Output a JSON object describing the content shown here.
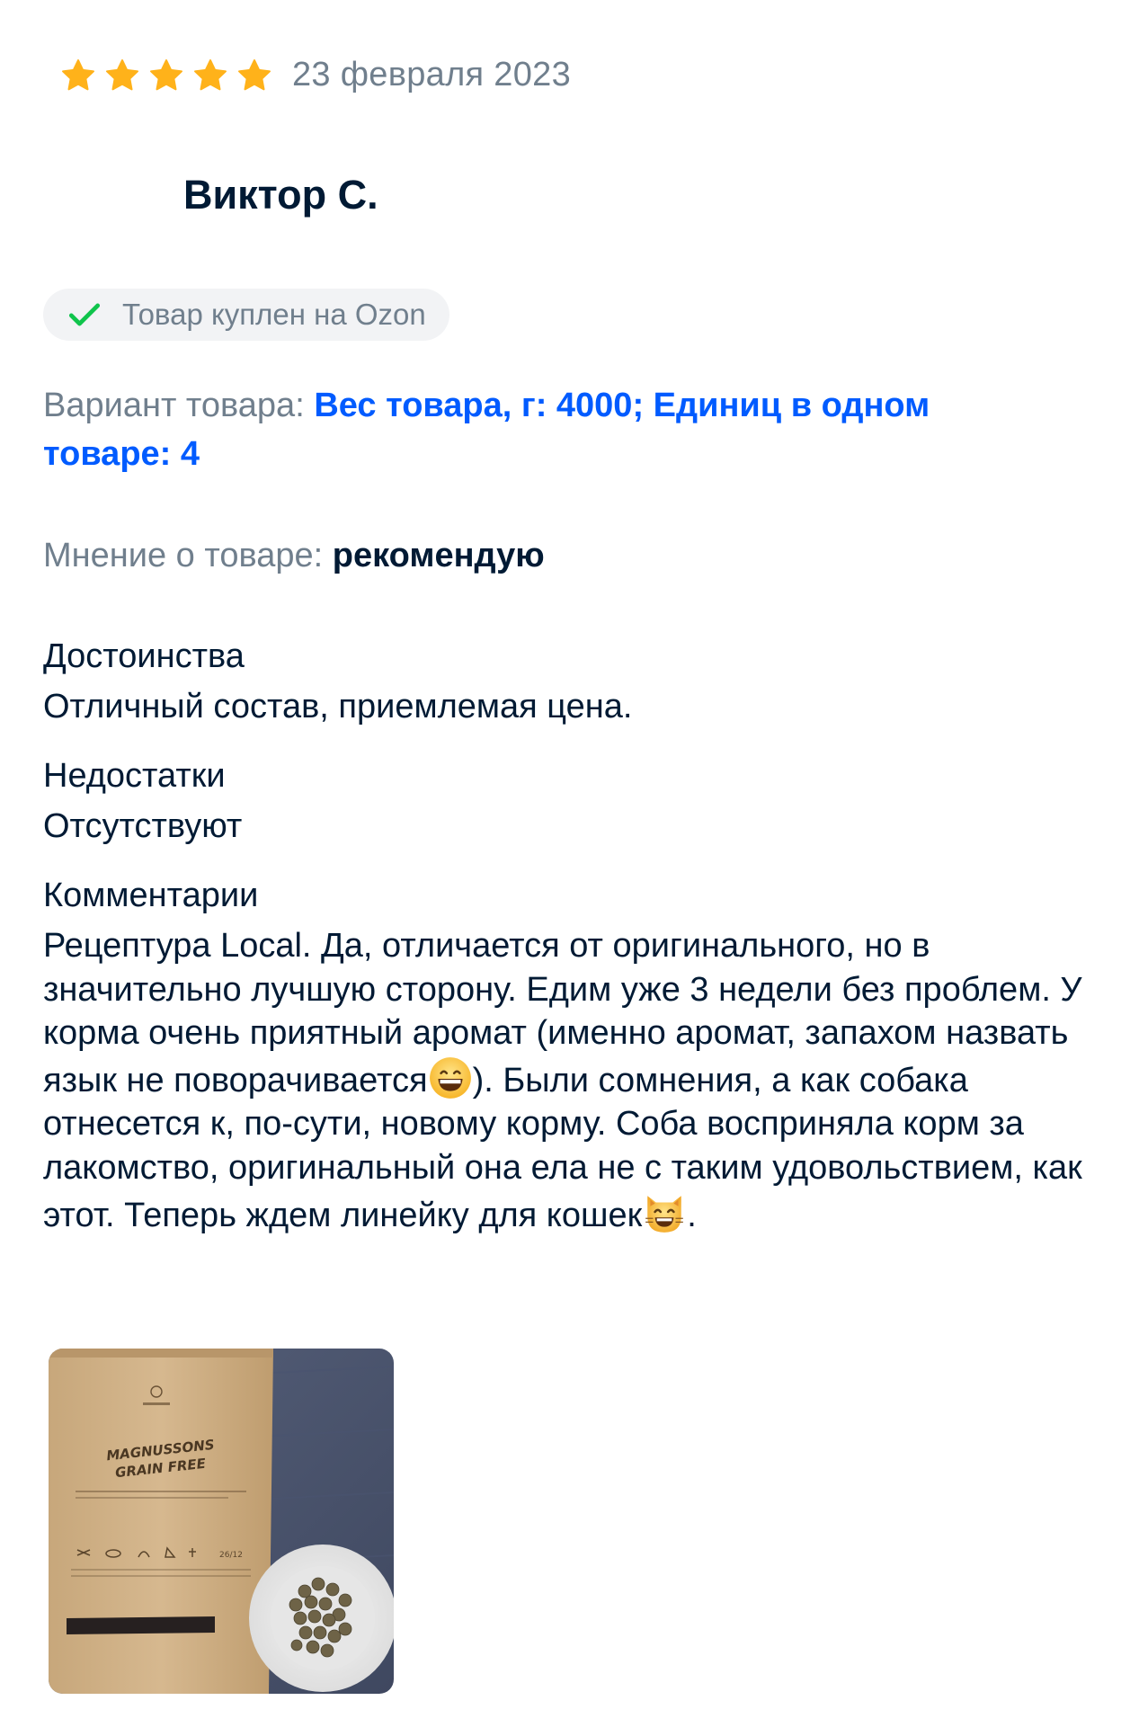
{
  "review": {
    "rating": 5,
    "rating_max": 5,
    "star_color": "#ffb21a",
    "date": "23 февраля 2023",
    "author": "Виктор С.",
    "purchased_badge": "Товар куплен на Ozon",
    "variant": {
      "label": "Вариант товара:",
      "value": "Вес товара, г: 4000; Единиц в одном товаре: 4"
    },
    "opinion": {
      "label": "Мнение о товаре:",
      "value": "рекомендую"
    },
    "pros": {
      "title": "Достоинства",
      "text": "Отличный состав, приемлемая цена."
    },
    "cons": {
      "title": "Недостатки",
      "text": "Отсутствуют"
    },
    "comments": {
      "title": "Комментарии",
      "text_1": "Рецептура Local. Да, отличается от оригинального, но в значительно лучшую сторону. Едим уже 3 недели без проблем. У корма очень приятный аромат (именно аромат, запахом назвать язык не поворачивается",
      "emoji_1": "grinning-face-emoji",
      "text_2": "). Были сомнения, а как собака отнесется к, по-сути, новому корму. Соба восприняла корм за лакомство, оригинальный она ела не с таким удовольствием, как этот. Теперь ждем линейку для кошек",
      "emoji_2": "smiling-cat-emoji",
      "text_3": "."
    },
    "photo": {
      "package_title_line1": "MAGNUSSONS",
      "package_title_line2": "GRAIN FREE"
    },
    "colors": {
      "text_primary": "#001a34",
      "text_secondary": "#707f8d",
      "link_blue": "#005bff",
      "badge_bg": "#f2f3f5",
      "check_green": "#10c44c"
    }
  }
}
